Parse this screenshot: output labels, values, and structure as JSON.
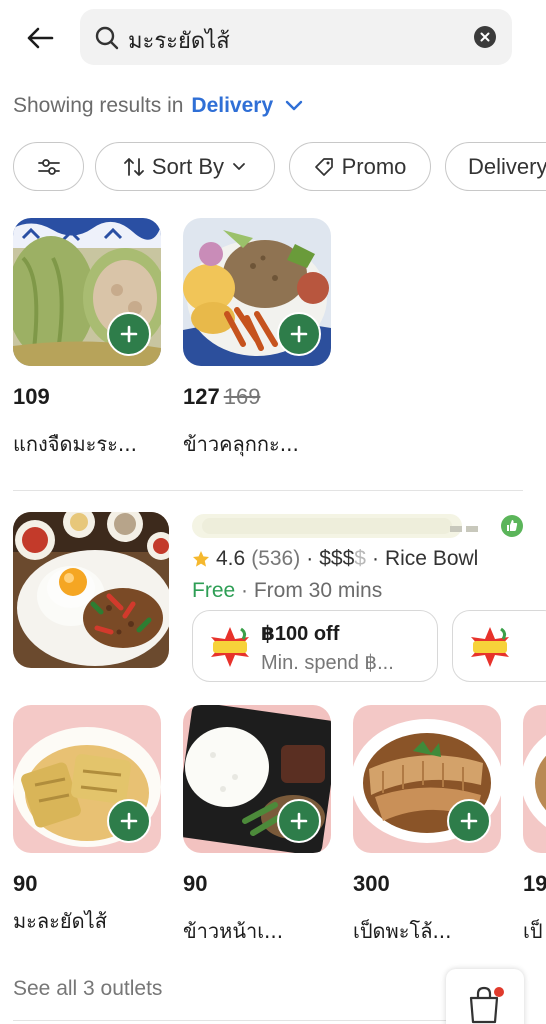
{
  "search": {
    "query": "มะระยัดไส้"
  },
  "results": {
    "prefix": "Showing results in",
    "mode": "Delivery"
  },
  "filters": {
    "sort_label": "Sort By",
    "promo_label": "Promo",
    "delivery_label": "Delivery"
  },
  "group1": {
    "dishes": [
      {
        "price": "109",
        "old_price": "",
        "name": "แกงจืดมะระ..."
      },
      {
        "price": "127",
        "old_price": "169",
        "name": "ข้าวคลุกกะ..."
      }
    ]
  },
  "outlet": {
    "rating": "4.6",
    "reviews": "(536)",
    "price_active": "$$$",
    "price_inactive": "$",
    "category": "Rice Bowl",
    "delivery_fee": "Free",
    "eta": "From 30 mins",
    "promos": [
      {
        "badge": "โค้ดลดแรง",
        "title": "฿100 off",
        "subtitle": "Min. spend ฿..."
      },
      {
        "badge": "โค้ดลดแรง",
        "title": "",
        "subtitle": ""
      }
    ]
  },
  "group2": {
    "dishes": [
      {
        "price": "90",
        "name": "มะละยัดไส้"
      },
      {
        "price": "90",
        "name": "ข้าวหน้าเ..."
      },
      {
        "price": "300",
        "name": "เป็ดพะโล้..."
      },
      {
        "price": "19",
        "name": "เป็"
      }
    ]
  },
  "footer": {
    "see_all": "See all 3 outlets"
  },
  "colors": {
    "accent": "#2e7d4a",
    "link": "#2f6fd6",
    "free": "#2e9e55",
    "star": "#f5b82e"
  }
}
